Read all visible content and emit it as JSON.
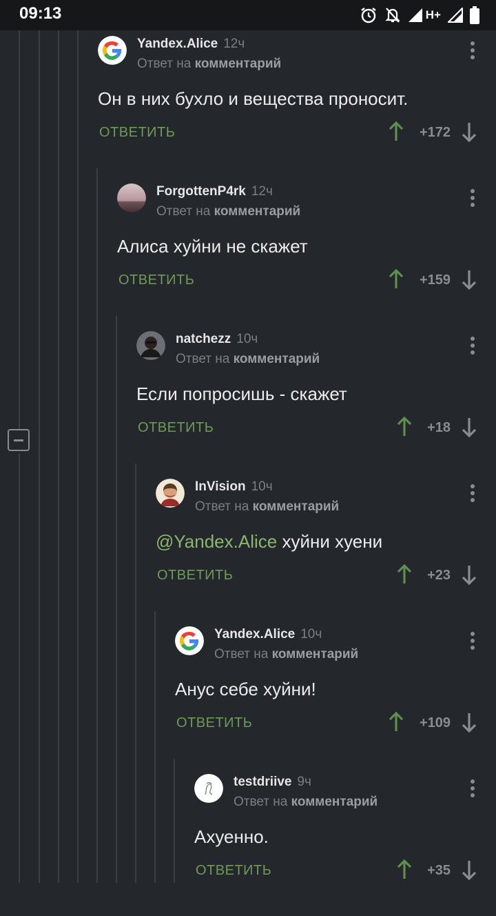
{
  "status_bar": {
    "time": "09:13",
    "network": "H+",
    "icons": [
      "alarm-icon",
      "mute-icon",
      "signal-icon",
      "signal-icon",
      "battery-icon"
    ]
  },
  "colors": {
    "background": "#24272b",
    "reply_green": "#6f9a57",
    "upvote_green": "#5f8f4e",
    "mention_green": "#8ab66e",
    "muted": "#7b7f84"
  },
  "reply_prefix": "Ответ на",
  "reply_target": "комментарий",
  "reply_label": "ОТВЕТИТЬ",
  "comments": [
    {
      "author": "Yandex.Alice",
      "time": "12ч",
      "text": "Он в них бухло и вещества проносит.",
      "mention": "",
      "score": "+172",
      "avatar": "google-logo-icon"
    },
    {
      "author": "ForgottenP4rk",
      "time": "12ч",
      "text": "Алиса хуйни не скажет",
      "mention": "",
      "score": "+159",
      "avatar": "planet-avatar"
    },
    {
      "author": "natchezz",
      "time": "10ч",
      "text": "Если попросишь - скажет",
      "mention": "",
      "score": "+18",
      "avatar": "person-avatar"
    },
    {
      "author": "InVision",
      "time": "10ч",
      "text": " хуйни хуени",
      "mention": "@Yandex.Alice",
      "score": "+23",
      "avatar": "cartoon-avatar"
    },
    {
      "author": "Yandex.Alice",
      "time": "10ч",
      "text": "Анус себе хуйни!",
      "mention": "",
      "score": "+109",
      "avatar": "google-logo-icon"
    },
    {
      "author": "testdriive",
      "time": "9ч",
      "text": "Ахуенно.",
      "mention": "",
      "score": "+35",
      "avatar": "sketch-avatar"
    }
  ]
}
